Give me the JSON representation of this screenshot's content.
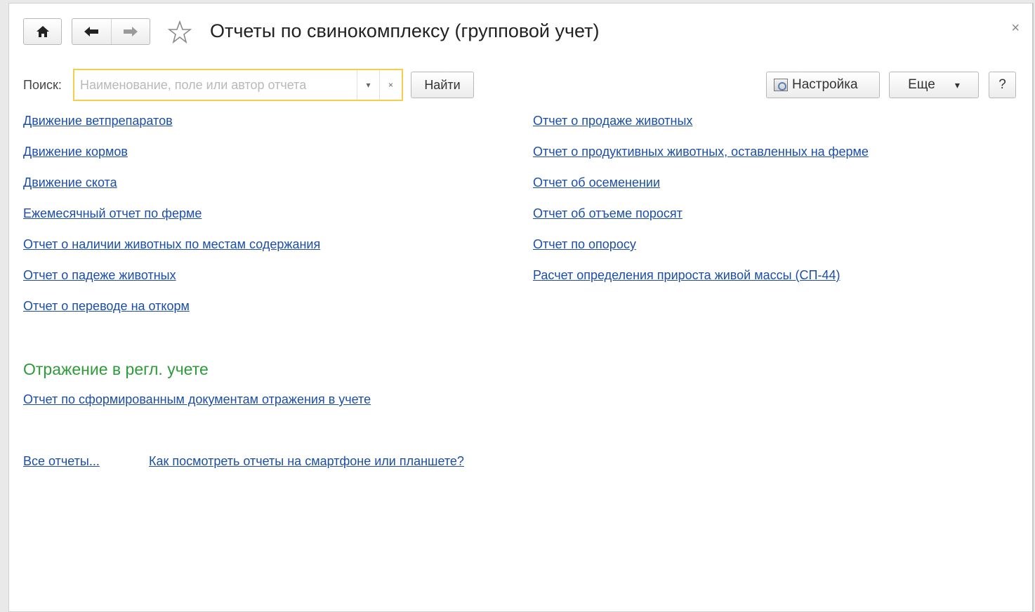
{
  "window": {
    "title": "Отчеты по свинокомплексу (групповой учет)",
    "close_label": "×"
  },
  "toolbar": {
    "home_icon": "home-icon",
    "back_icon": "arrow-left-icon",
    "forward_icon": "arrow-right-icon",
    "favorite_icon": "star-icon"
  },
  "search": {
    "label": "Поиск:",
    "value": "",
    "placeholder": "Наименование, поле или автор отчета",
    "dropdown_glyph": "▾",
    "clear_glyph": "×",
    "find_button": "Найти"
  },
  "actions": {
    "settings": "Настройка",
    "more": "Еще",
    "more_glyph": "▾",
    "help": "?"
  },
  "reports_left": [
    "Движение ветпрепаратов",
    "Движение кормов",
    "Движение скота",
    "Ежемесячный отчет по ферме",
    "Отчет о наличии животных по местам содержания",
    "Отчет о падеже животных",
    "Отчет о переводе на откорм"
  ],
  "reports_right": [
    "Отчет о продаже животных",
    "Отчет о продуктивных животных, оставленных на ферме",
    "Отчет об осеменении",
    "Отчет об отъеме поросят",
    "Отчет по опоросу",
    "Расчет определения прироста живой массы (СП-44)"
  ],
  "section": {
    "title": "Отражение в регл. учете",
    "reports": [
      "Отчет по сформированным документам отражения в учете"
    ]
  },
  "footer": {
    "all_reports": "Все отчеты...",
    "mobile_help": "Как посмотреть отчеты на смартфоне или планшете?"
  }
}
